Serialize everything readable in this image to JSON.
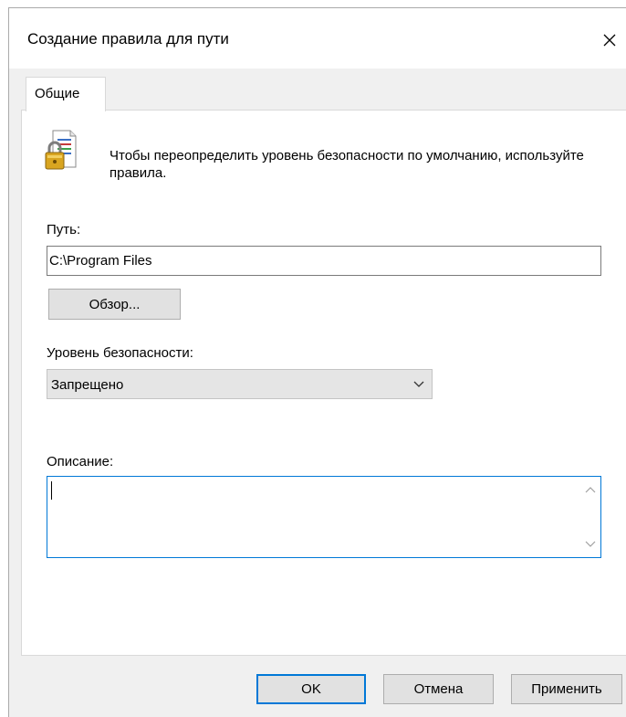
{
  "window": {
    "title": "Создание правила для пути"
  },
  "tabs": [
    {
      "label": "Общие",
      "selected": true
    }
  ],
  "panel": {
    "icon": "security-policy-document-icon",
    "info_text": "Чтобы переопределить уровень безопасности по умолчанию, используйте правила.",
    "path_label": "Путь:",
    "path_value": "C:\\Program Files",
    "browse_label": "Обзор...",
    "security_level_label": "Уровень безопасности:",
    "security_level_value": "Запрещено",
    "description_label": "Описание:",
    "description_value": ""
  },
  "buttons": {
    "ok": "OK",
    "cancel": "Отмена",
    "apply": "Применить"
  },
  "colors": {
    "accent": "#0078d7",
    "dialog_bg": "#f0f0f0",
    "button_bg": "#e1e1e1"
  }
}
